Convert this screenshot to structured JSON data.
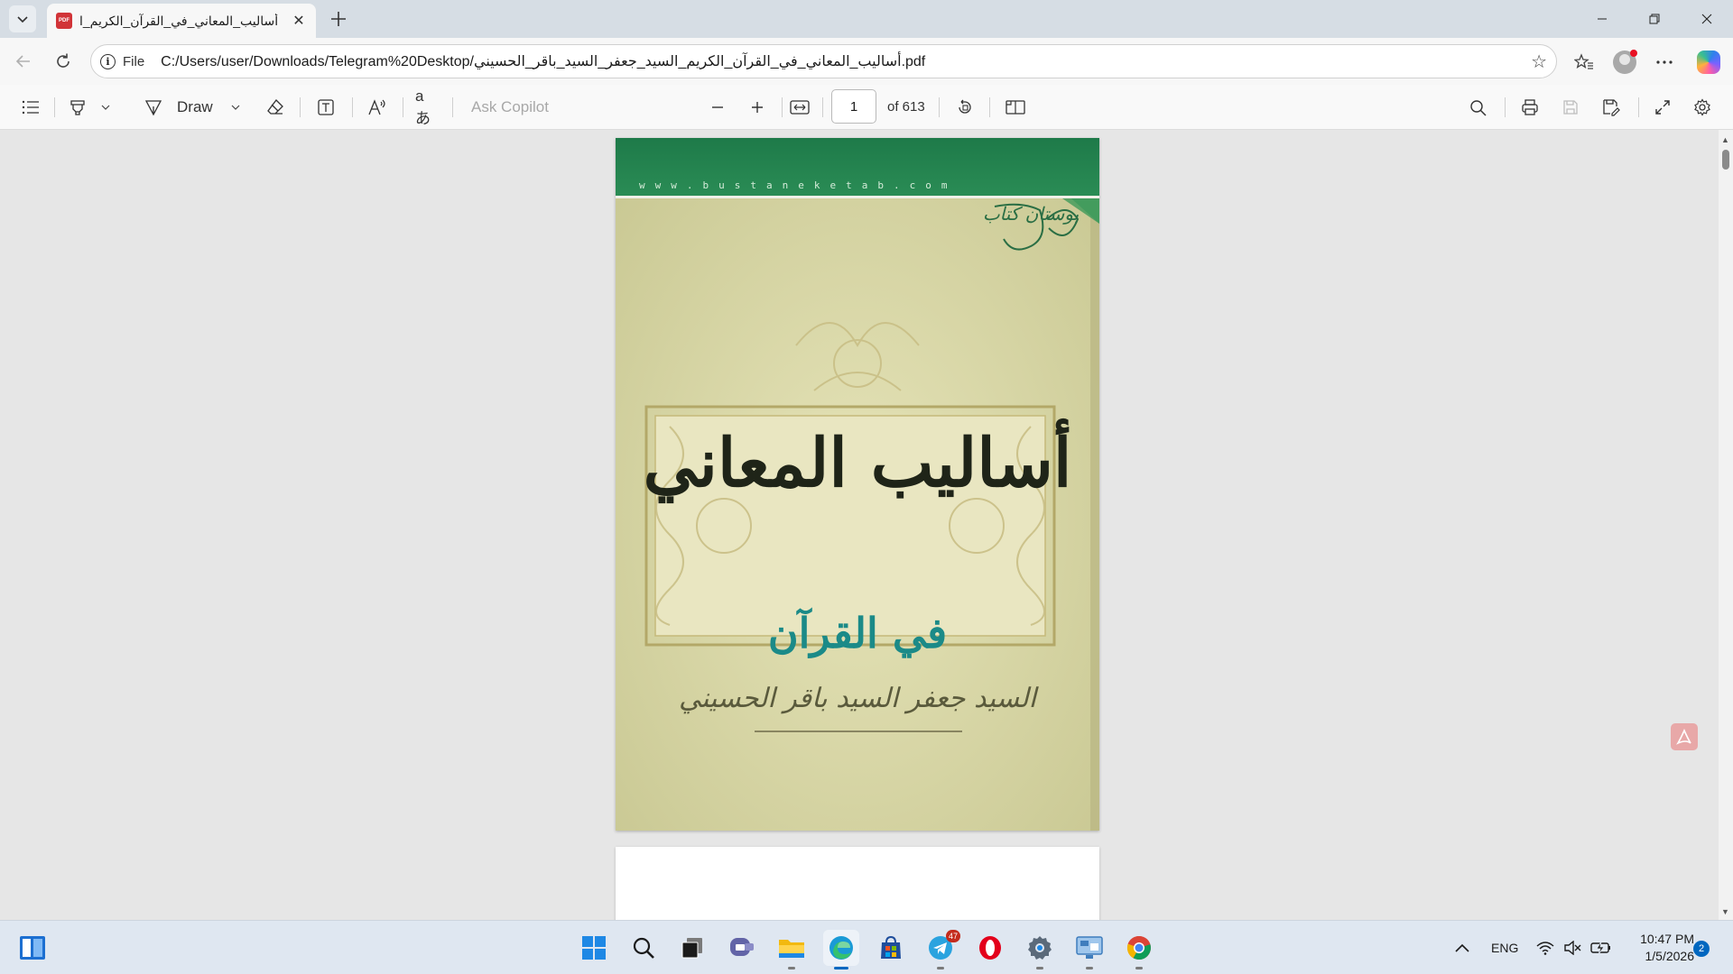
{
  "tab": {
    "title": "أساليب_المعاني_في_القرآن_الكريم_ا",
    "favicon_text": "PDF"
  },
  "address": {
    "scheme_label": "File",
    "url": "C:/Users/user/Downloads/Telegram%20Desktop/أساليب_المعاني_في_القرآن_الكريم_السيد_جعفر_السيد_باقر_الحسيني.pdf"
  },
  "pdf_toolbar": {
    "draw_label": "Draw",
    "ask_copilot_placeholder": "Ask Copilot",
    "page_number": "1",
    "page_total": "of 613"
  },
  "cover": {
    "website": "www.bustaneketab.com",
    "publisher_logo_text": "بوستان کتاب",
    "title": "أساليب المعاني",
    "subtitle": "في القرآن",
    "author": "السيد جعفر السيد باقر الحسيني",
    "colors": {
      "band": "#1e7a49",
      "paper": "#d8d7a8",
      "subtitle": "#1b8a88"
    }
  },
  "taskbar": {
    "telegram_badge": "47",
    "language": "ENG",
    "time": "10:47 PM",
    "date": "1/5/2026",
    "notifications": "2",
    "apps": [
      "start-icon",
      "search-icon",
      "task-view-icon",
      "teams-icon",
      "file-explorer-icon",
      "edge-icon",
      "store-icon",
      "telegram-icon",
      "opera-icon",
      "settings-icon",
      "remote-desktop-icon",
      "chrome-icon"
    ]
  }
}
